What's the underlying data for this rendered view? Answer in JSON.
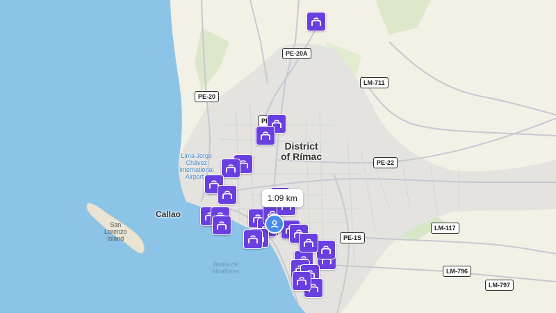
{
  "map": {
    "colors": {
      "sea": "#8cc4e8",
      "land": "#f3f0e6",
      "urban": "#e6e5e1",
      "park": "#cfe3bd",
      "marker": "#6a3fe0",
      "user": "#4a8de8"
    },
    "shields": [
      {
        "id": "pe20a",
        "text": "PE-20A"
      },
      {
        "id": "lm711",
        "text": "LM-711"
      },
      {
        "id": "pe20",
        "text": "PE-20"
      },
      {
        "id": "pe-cut",
        "text": "PE-"
      },
      {
        "id": "pe22",
        "text": "PE-22"
      },
      {
        "id": "lm117",
        "text": "LM-117"
      },
      {
        "id": "pe1s",
        "text": "PE-1S"
      },
      {
        "id": "lm796",
        "text": "LM-796"
      },
      {
        "id": "lm797",
        "text": "LM-797"
      }
    ],
    "district": {
      "line1": "District",
      "line2": "of Rímac"
    },
    "city": "Callao",
    "island": {
      "line1": "San",
      "line2": "Lorenzo",
      "line3": "Island"
    },
    "bay": {
      "line1": "Bahía de",
      "line2": "Miraflores"
    },
    "airport": {
      "line1": "Lima Jorge",
      "line2": "Chávez",
      "line3": "International",
      "line4": "Airport ("
    },
    "distance_label": "1.09 km",
    "marker_icon": "briefcase-icon",
    "marker_count": 27,
    "user_icon": "person-icon"
  }
}
